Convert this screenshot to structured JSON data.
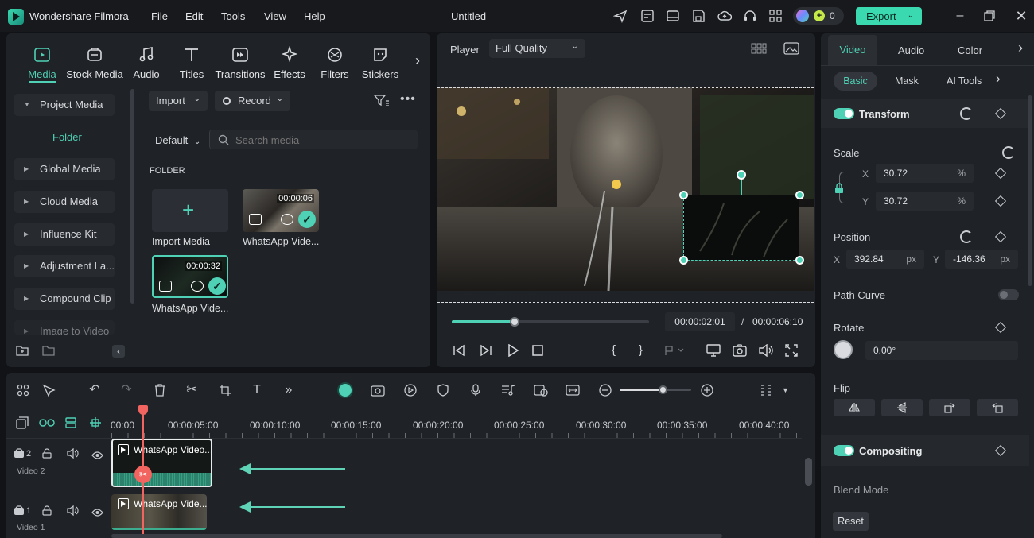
{
  "app": {
    "name": "Wondershare Filmora",
    "project_title": "Untitled",
    "points": "0",
    "export_label": "Export"
  },
  "menu": [
    "File",
    "Edit",
    "Tools",
    "View",
    "Help"
  ],
  "media_tabs": [
    {
      "label": "Media",
      "icon": "media-icon",
      "active": true
    },
    {
      "label": "Stock Media",
      "icon": "stock-media-icon"
    },
    {
      "label": "Audio",
      "icon": "music-note-icon"
    },
    {
      "label": "Titles",
      "icon": "text-t-icon"
    },
    {
      "label": "Transitions",
      "icon": "transition-icon"
    },
    {
      "label": "Effects",
      "icon": "effects-sparkle-icon"
    },
    {
      "label": "Filters",
      "icon": "filter-icon"
    },
    {
      "label": "Stickers",
      "icon": "sticker-icon"
    }
  ],
  "sidebar": {
    "project_media": "Project Media",
    "folder": "Folder",
    "items": [
      "Global Media",
      "Cloud Media",
      "Influence Kit",
      "Adjustment La...",
      "Compound Clip",
      "Image to Video"
    ]
  },
  "media_browser": {
    "import_label": "Import",
    "record_label": "Record",
    "sort_label": "Default",
    "search_placeholder": "Search media",
    "section_label": "FOLDER",
    "items": [
      {
        "label": "Import Media"
      },
      {
        "label": "WhatsApp Vide...",
        "duration": "00:00:06"
      },
      {
        "label": "WhatsApp Vide...",
        "duration": "00:00:32"
      }
    ]
  },
  "player": {
    "label": "Player",
    "quality": "Full Quality",
    "current_time": "00:00:02:01",
    "separator": "/",
    "total_time": "00:00:06:10",
    "progress": 0.32
  },
  "right_panel": {
    "tabs": [
      "Video",
      "Audio",
      "Color"
    ],
    "subtabs": [
      "Basic",
      "Mask",
      "AI Tools"
    ],
    "transform_label": "Transform",
    "scale_label": "Scale",
    "scale_x_label": "X",
    "scale_x": "30.72",
    "scale_y_label": "Y",
    "scale_y": "30.72",
    "percent_unit": "%",
    "position_label": "Position",
    "pos_x_label": "X",
    "pos_x": "392.84",
    "pos_y_label": "Y",
    "pos_y": "-146.36",
    "px_unit": "px",
    "path_curve_label": "Path Curve",
    "rotate_label": "Rotate",
    "rotate_value": "0.00°",
    "flip_label": "Flip",
    "compositing_label": "Compositing",
    "blend_mode_label": "Blend Mode",
    "reset_label": "Reset"
  },
  "timeline": {
    "ruler": [
      "00:00",
      "00:00:05:00",
      "00:00:10:00",
      "00:00:15:00",
      "00:00:20:00",
      "00:00:25:00",
      "00:00:30:00",
      "00:00:35:00",
      "00:00:40:00"
    ],
    "zoom": 0.6,
    "tracks": [
      {
        "number": "2",
        "name": "Video 2",
        "clip": "WhatsApp Video..."
      },
      {
        "number": "1",
        "name": "Video 1",
        "clip": "WhatsApp Vide..."
      }
    ]
  },
  "colors": {
    "accent": "#4fd1b5",
    "export": "#3ad9b0",
    "playhead": "#f2645f"
  }
}
